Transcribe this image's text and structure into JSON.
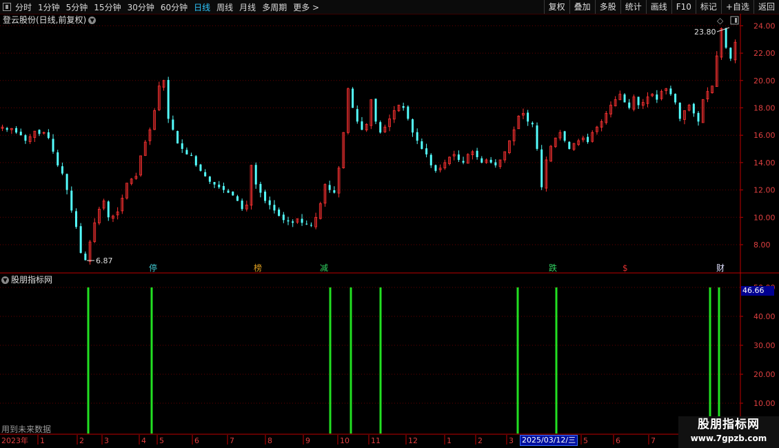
{
  "toolbar": {
    "periods": [
      "分时",
      "1分钟",
      "5分钟",
      "15分钟",
      "30分钟",
      "60分钟",
      "日线",
      "周线",
      "月线",
      "多周期",
      "更多 >"
    ],
    "active_period": "日线",
    "right_buttons": [
      "复权",
      "叠加",
      "多股",
      "统计",
      "画线",
      "F10",
      "标记",
      "+自选",
      "返回"
    ]
  },
  "main_chart": {
    "title": "登云股份(日线,前复权)",
    "high_label": "23.80",
    "low_label": "6.87",
    "markers": [
      {
        "text": "停",
        "color": "#40c8d0"
      },
      {
        "text": "榜",
        "color": "#e0a020"
      },
      {
        "text": "减",
        "color": "#30d060"
      },
      {
        "text": "跌",
        "color": "#30d060"
      },
      {
        "text": "$",
        "color": "#e03030"
      },
      {
        "text": "财",
        "color": "#e0e0ff"
      }
    ]
  },
  "indicator": {
    "title": "股朋指标网",
    "value": "46.66",
    "future_text": "用到未来数据"
  },
  "date_axis": {
    "year_label": "2023年",
    "months": [
      "1",
      "2",
      "3",
      "4",
      "5",
      "6",
      "7",
      "8",
      "9",
      "10",
      "11",
      "12",
      "1",
      "2",
      "3",
      "5",
      "6",
      "7"
    ],
    "cursor_date": "2025/03/12/三"
  },
  "watermark": {
    "line1": "股朋指标网",
    "line2": "www.7gpzb.com"
  },
  "chart_data": [
    {
      "type": "candlestick",
      "title": "登云股份(日线,前复权)",
      "ylim": [
        7.0,
        24.5
      ],
      "yticks": [
        "24.00",
        "22.00",
        "20.00",
        "18.00",
        "16.00",
        "14.00",
        "12.00",
        "10.00",
        "8.00"
      ],
      "close_path": [
        16.6,
        16.4,
        16.5,
        16.2,
        16.0,
        15.6,
        15.9,
        16.3,
        16.1,
        16.2,
        15.8,
        14.8,
        13.8,
        13.2,
        12.0,
        10.5,
        9.3,
        7.4,
        6.87,
        8.2,
        9.6,
        10.6,
        11.2,
        10.0,
        10.1,
        10.4,
        11.4,
        12.5,
        12.8,
        13.0,
        14.5,
        15.5,
        16.4,
        17.8,
        19.6,
        20.0,
        17.2,
        16.4,
        15.4,
        15.0,
        14.6,
        14.5,
        13.8,
        13.4,
        13.0,
        12.6,
        12.4,
        12.2,
        12.0,
        11.8,
        11.6,
        11.2,
        10.6,
        10.9,
        13.8,
        12.4,
        11.8,
        11.2,
        10.9,
        10.5,
        10.1,
        9.8,
        9.7,
        9.6,
        9.9,
        9.6,
        9.5,
        9.4,
        10.0,
        11.0,
        12.4,
        12.0,
        11.8,
        13.6,
        16.2,
        19.4,
        18.0,
        17.0,
        16.4,
        16.8,
        18.6,
        17.0,
        16.2,
        16.6,
        17.2,
        17.8,
        18.2,
        18.0,
        17.2,
        16.2,
        15.6,
        15.0,
        14.6,
        13.8,
        13.4,
        13.6,
        14.0,
        14.4,
        14.6,
        14.2,
        14.0,
        14.6,
        14.8,
        14.4,
        14.0,
        14.2,
        14.0,
        13.8,
        14.2,
        14.8,
        15.6,
        16.4,
        17.4,
        17.6,
        17.0,
        16.8,
        15.0,
        12.2,
        14.2,
        15.2,
        15.8,
        16.2,
        15.6,
        15.0,
        15.4,
        15.6,
        15.8,
        15.5,
        16.2,
        16.6,
        17.0,
        17.6,
        18.2,
        18.6,
        19.0,
        18.4,
        18.0,
        18.8,
        18.2,
        18.4,
        18.8,
        19.0,
        18.6,
        19.2,
        19.4,
        19.0,
        18.4,
        17.2,
        17.8,
        18.2,
        17.6,
        17.0,
        18.6,
        19.2,
        19.6,
        21.8,
        23.8,
        22.4,
        21.6,
        22.8
      ]
    },
    {
      "type": "bar",
      "title": "股朋指标网",
      "ylim": [
        0,
        50
      ],
      "yticks": [
        "50.00",
        "40.00",
        "30.00",
        "20.00",
        "10.00"
      ],
      "values": [
        50,
        50,
        50,
        50,
        50,
        50,
        50,
        50,
        50
      ],
      "current_value": 46.66
    }
  ]
}
